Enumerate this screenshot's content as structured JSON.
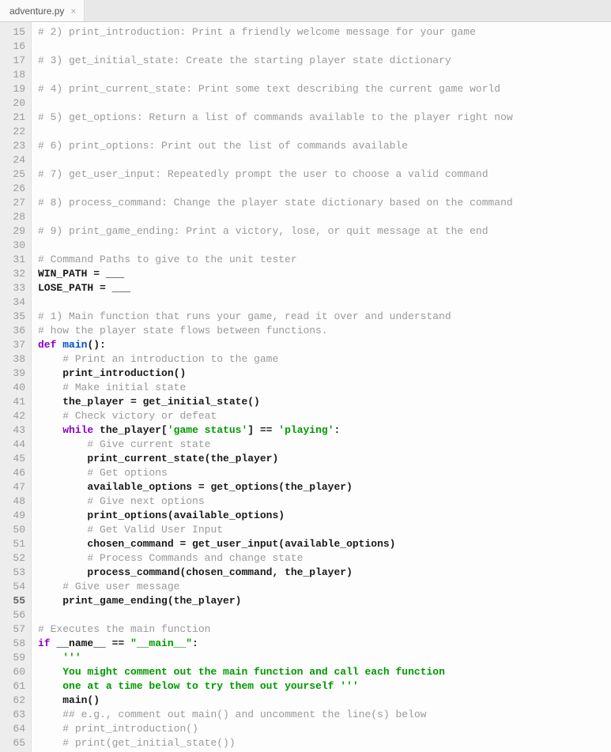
{
  "tab": {
    "name": "adventure.py",
    "close": "×"
  },
  "gutter": {
    "start": 15,
    "end": 65,
    "current": 55
  },
  "code": [
    {
      "indent": 0,
      "segs": [
        {
          "t": "comment",
          "v": "# 2) print_introduction: Print a friendly welcome message for your game"
        }
      ]
    },
    {
      "indent": 0,
      "segs": []
    },
    {
      "indent": 0,
      "segs": [
        {
          "t": "comment",
          "v": "# 3) get_initial_state: Create the starting player state dictionary"
        }
      ]
    },
    {
      "indent": 0,
      "segs": []
    },
    {
      "indent": 0,
      "segs": [
        {
          "t": "comment",
          "v": "# 4) print_current_state: Print some text describing the current game world"
        }
      ]
    },
    {
      "indent": 0,
      "segs": []
    },
    {
      "indent": 0,
      "segs": [
        {
          "t": "comment",
          "v": "# 5) get_options: Return a list of commands available to the player right now"
        }
      ]
    },
    {
      "indent": 0,
      "segs": []
    },
    {
      "indent": 0,
      "segs": [
        {
          "t": "comment",
          "v": "# 6) print_options: Print out the list of commands available"
        }
      ]
    },
    {
      "indent": 0,
      "segs": []
    },
    {
      "indent": 0,
      "segs": [
        {
          "t": "comment",
          "v": "# 7) get_user_input: Repeatedly prompt the user to choose a valid command"
        }
      ]
    },
    {
      "indent": 0,
      "segs": []
    },
    {
      "indent": 0,
      "segs": [
        {
          "t": "comment",
          "v": "# 8) process_command: Change the player state dictionary based on the command"
        }
      ]
    },
    {
      "indent": 0,
      "segs": []
    },
    {
      "indent": 0,
      "segs": [
        {
          "t": "comment",
          "v": "# 9) print_game_ending: Print a victory, lose, or quit message at the end"
        }
      ]
    },
    {
      "indent": 0,
      "segs": []
    },
    {
      "indent": 0,
      "segs": [
        {
          "t": "comment",
          "v": "# Command Paths to give to the unit tester"
        }
      ]
    },
    {
      "indent": 0,
      "segs": [
        {
          "t": "plain",
          "v": "WIN_PATH = ___"
        }
      ]
    },
    {
      "indent": 0,
      "segs": [
        {
          "t": "plain",
          "v": "LOSE_PATH = ___"
        }
      ]
    },
    {
      "indent": 0,
      "segs": []
    },
    {
      "indent": 0,
      "segs": [
        {
          "t": "comment",
          "v": "# 1) Main function that runs your game, read it over and understand"
        }
      ]
    },
    {
      "indent": 0,
      "segs": [
        {
          "t": "comment",
          "v": "# how the player state flows between functions."
        }
      ]
    },
    {
      "indent": 0,
      "segs": [
        {
          "t": "keyword",
          "v": "def"
        },
        {
          "t": "plain",
          "v": " "
        },
        {
          "t": "deffunc",
          "v": "main"
        },
        {
          "t": "punct",
          "v": "():"
        }
      ]
    },
    {
      "indent": 1,
      "segs": [
        {
          "t": "comment",
          "v": "# Print an introduction to the game"
        }
      ]
    },
    {
      "indent": 1,
      "segs": [
        {
          "t": "plain",
          "v": "print_introduction()"
        }
      ]
    },
    {
      "indent": 1,
      "segs": [
        {
          "t": "comment",
          "v": "# Make initial state"
        }
      ]
    },
    {
      "indent": 1,
      "segs": [
        {
          "t": "plain",
          "v": "the_player = get_initial_state()"
        }
      ]
    },
    {
      "indent": 1,
      "segs": [
        {
          "t": "comment",
          "v": "# Check victory or defeat"
        }
      ]
    },
    {
      "indent": 1,
      "segs": [
        {
          "t": "keyword",
          "v": "while"
        },
        {
          "t": "plain",
          "v": " the_player["
        },
        {
          "t": "string",
          "v": "'game status'"
        },
        {
          "t": "plain",
          "v": "] == "
        },
        {
          "t": "string",
          "v": "'playing'"
        },
        {
          "t": "plain",
          "v": ":"
        }
      ]
    },
    {
      "indent": 2,
      "segs": [
        {
          "t": "comment",
          "v": "# Give current state"
        }
      ]
    },
    {
      "indent": 2,
      "segs": [
        {
          "t": "plain",
          "v": "print_current_state(the_player)"
        }
      ]
    },
    {
      "indent": 2,
      "segs": [
        {
          "t": "comment",
          "v": "# Get options"
        }
      ]
    },
    {
      "indent": 2,
      "segs": [
        {
          "t": "plain",
          "v": "available_options = get_options(the_player)"
        }
      ]
    },
    {
      "indent": 2,
      "segs": [
        {
          "t": "comment",
          "v": "# Give next options"
        }
      ]
    },
    {
      "indent": 2,
      "segs": [
        {
          "t": "plain",
          "v": "print_options(available_options)"
        }
      ]
    },
    {
      "indent": 2,
      "segs": [
        {
          "t": "comment",
          "v": "# Get Valid User Input"
        }
      ]
    },
    {
      "indent": 2,
      "segs": [
        {
          "t": "plain",
          "v": "chosen_command = get_user_input(available_options)"
        }
      ]
    },
    {
      "indent": 2,
      "segs": [
        {
          "t": "comment",
          "v": "# Process Commands and change state"
        }
      ]
    },
    {
      "indent": 2,
      "segs": [
        {
          "t": "plain",
          "v": "process_command(chosen_command, the_player)"
        }
      ]
    },
    {
      "indent": 1,
      "segs": [
        {
          "t": "comment",
          "v": "# Give user message"
        }
      ]
    },
    {
      "indent": 1,
      "segs": [
        {
          "t": "plain",
          "v": "print_game_ending(the_player)"
        }
      ]
    },
    {
      "indent": 0,
      "segs": []
    },
    {
      "indent": 0,
      "segs": [
        {
          "t": "comment",
          "v": "# Executes the main function"
        }
      ]
    },
    {
      "indent": 0,
      "segs": [
        {
          "t": "keyword",
          "v": "if"
        },
        {
          "t": "plain",
          "v": " __name__ == "
        },
        {
          "t": "string",
          "v": "\"__main__\""
        },
        {
          "t": "plain",
          "v": ":"
        }
      ]
    },
    {
      "indent": 1,
      "segs": [
        {
          "t": "string",
          "v": "'''"
        }
      ]
    },
    {
      "indent": 1,
      "segs": [
        {
          "t": "string",
          "v": "You might comment out the main function and call each function"
        }
      ]
    },
    {
      "indent": 1,
      "segs": [
        {
          "t": "string",
          "v": "one at a time below to try them out yourself '''"
        }
      ]
    },
    {
      "indent": 1,
      "segs": [
        {
          "t": "plain",
          "v": "main()"
        }
      ]
    },
    {
      "indent": 1,
      "segs": [
        {
          "t": "comment",
          "v": "## e.g., comment out main() and uncomment the line(s) below"
        }
      ]
    },
    {
      "indent": 1,
      "segs": [
        {
          "t": "comment",
          "v": "# print_introduction()"
        }
      ]
    },
    {
      "indent": 1,
      "segs": [
        {
          "t": "comment",
          "v": "# print(get_initial_state())"
        }
      ]
    }
  ]
}
